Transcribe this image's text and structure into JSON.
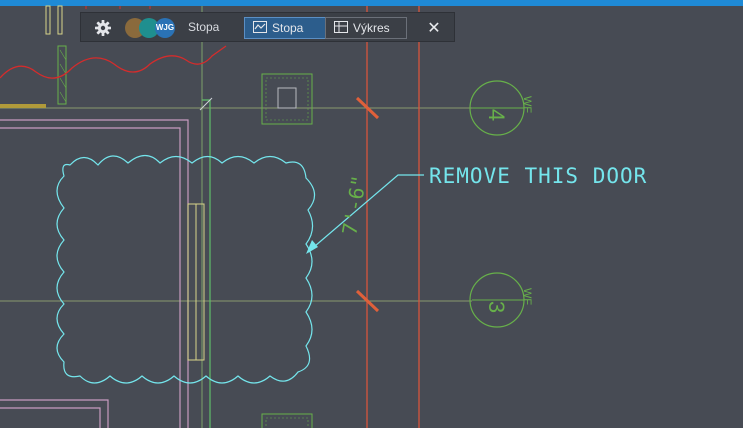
{
  "toolbar": {
    "title": "Stopa",
    "avatars": [
      {
        "initials": "",
        "color": "#8a6a3c"
      },
      {
        "initials": "",
        "color": "#1f8f8f"
      },
      {
        "initials": "WJG",
        "color": "#2a72b5"
      }
    ],
    "tabs": [
      {
        "label": "Stopa",
        "icon": "trace-icon",
        "active": true
      },
      {
        "label": "Výkres",
        "icon": "drawing-icon",
        "active": false
      }
    ],
    "settings_icon": "gear-icon",
    "close_icon": "close-icon",
    "close_glyph": "✕"
  },
  "drawing": {
    "annotation": "REMOVE THIS DOOR",
    "dimension": "7'-6\"",
    "grid_markers": [
      {
        "number": "4",
        "suffix": "WF"
      },
      {
        "number": "3",
        "suffix": "WF"
      }
    ],
    "colors": {
      "background": "#474b54",
      "markup_cyan": "#74e5ec",
      "grid_green": "#67b04a",
      "wall_yellow": "#d9d48a",
      "red_line": "#d7553d",
      "curtain_red": "#d42c2c",
      "pink_wall": "#c79bc0"
    }
  }
}
